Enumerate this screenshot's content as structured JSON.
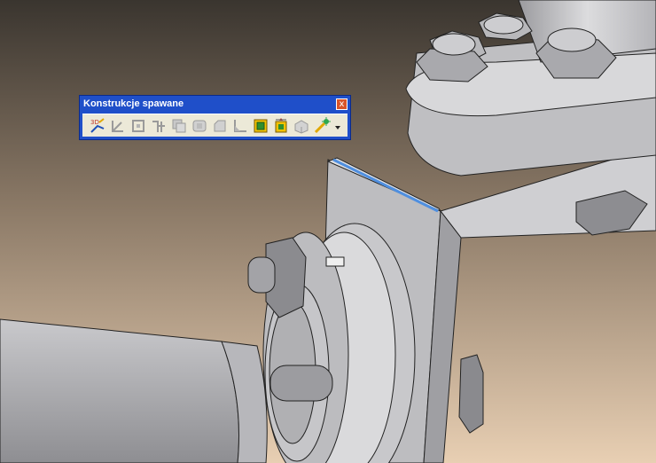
{
  "toolbar": {
    "title": "Konstrukcje spawane",
    "close_glyph": "x",
    "buttons": [
      {
        "icon": "3d-sketch-icon",
        "enabled": true
      },
      {
        "icon": "structural-member-icon",
        "enabled": false
      },
      {
        "icon": "trim-extend-icon",
        "enabled": false
      },
      {
        "icon": "gusset-icon",
        "enabled": false
      },
      {
        "icon": "end-cap-icon",
        "enabled": false
      },
      {
        "icon": "weld-bead-icon",
        "enabled": false
      },
      {
        "icon": "chamfer-icon",
        "enabled": false
      },
      {
        "icon": "fillet-bead-icon",
        "enabled": false
      },
      {
        "icon": "weldment-icon",
        "enabled": true
      },
      {
        "icon": "cut-list-icon",
        "enabled": true
      },
      {
        "icon": "extrude-icon",
        "enabled": false
      },
      {
        "icon": "update-icon",
        "enabled": true
      },
      {
        "icon": "dropdown-arrow-icon",
        "enabled": true
      }
    ]
  },
  "colors": {
    "background_top": "#3c3732",
    "background_bottom": "#e6cdb1",
    "part_face": "#d2d2d4",
    "edge_highlight": "#4f8fe0"
  }
}
